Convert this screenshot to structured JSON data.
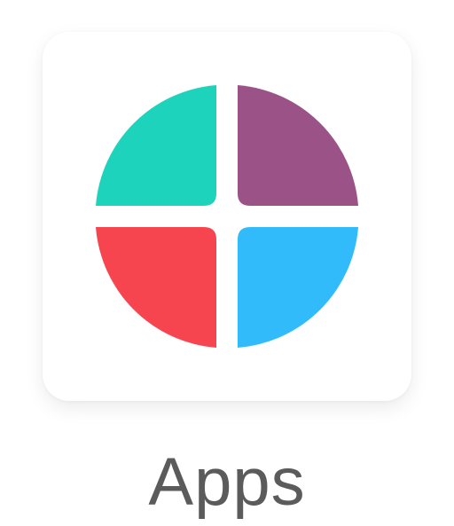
{
  "app": {
    "name": "Apps",
    "icon": "four-quadrant-circle-icon"
  },
  "colors": {
    "top_left": "#1dd3bc",
    "top_right": "#9a5287",
    "bottom_left": "#f6454f",
    "bottom_right": "#31bbfa",
    "label": "#5b5b5c",
    "tile_background": "#ffffff"
  }
}
